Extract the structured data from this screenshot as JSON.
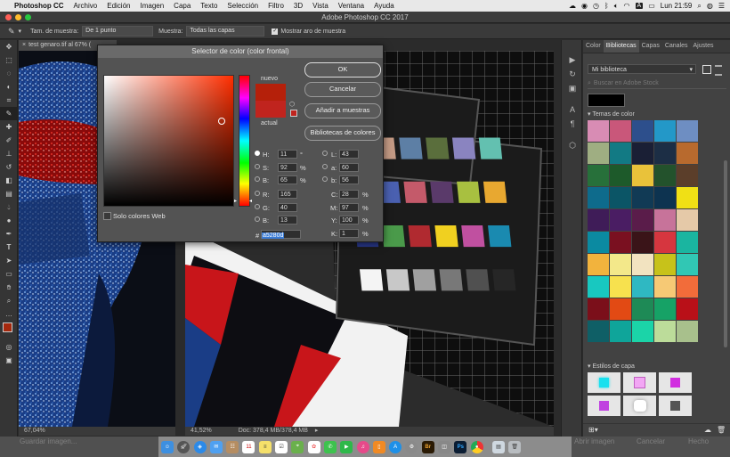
{
  "menubar": {
    "app": "Photoshop CC",
    "items": [
      "Archivo",
      "Edición",
      "Imagen",
      "Capa",
      "Texto",
      "Selección",
      "Filtro",
      "3D",
      "Vista",
      "Ventana",
      "Ayuda"
    ],
    "status": {
      "input_badge": "A",
      "clock": "Lun 21:59"
    }
  },
  "window": {
    "title": "Adobe Photoshop CC 2017"
  },
  "options": {
    "sample_size_label": "Tam. de muestra:",
    "sample_size_value": "De 1 punto",
    "sample_label": "Muestra:",
    "sample_value": "Todas las capas",
    "show_ring_label": "Mostrar aro de muestra"
  },
  "document": {
    "tab_title": "test genaro.tif al 67% (",
    "zoom_left": "67,04%",
    "zoom_right": "41,52%",
    "doc_size": "Doc: 378,4 MB/378,4 MB"
  },
  "dialog": {
    "title": "Selector de color (color frontal)",
    "new_label": "nuevo",
    "current_label": "actual",
    "ok": "OK",
    "cancel": "Cancelar",
    "add_swatches": "Añadir a muestras",
    "libraries": "Bibliotecas de colores",
    "web_only": "Solo colores Web",
    "new_color": "#b5200a",
    "current_color": "#c0241e",
    "hsb": {
      "H": "11",
      "S": "92",
      "B": "65",
      "H_unit": "°",
      "S_unit": "%",
      "B_unit": "%"
    },
    "rgb": {
      "R": "165",
      "G": "40",
      "B": "13"
    },
    "lab": {
      "L": "43",
      "a": "60",
      "b": "56"
    },
    "cmyk": {
      "C": "28",
      "M": "97",
      "Y": "100",
      "K": "1",
      "unit": "%"
    },
    "hex_prefix": "#",
    "hex": "a5280d"
  },
  "panel": {
    "tabs": [
      "Color",
      "Bibliotecas",
      "Capas",
      "Canales",
      "Ajustes"
    ],
    "library_name": "Mi biblioteca",
    "search_placeholder": "Buscar en Adobe Stock",
    "color_themes_label": "Temas de color",
    "layer_styles_label": "Estilos de capa",
    "swatches": [
      [
        "#d88cb4",
        "#c9577a",
        "#2d4f8c",
        "#2398c8",
        "#6e8ec2"
      ],
      [
        "#9fae82",
        "#127a84",
        "#1a1f35",
        "#1c2e45",
        "#b86a2e"
      ],
      [
        "#27703a",
        "#1d5a2a",
        "#e9c23a",
        "#23522c",
        "#5b3e2a"
      ],
      [
        "#0e6b8c",
        "#0b5566",
        "#113a55",
        "#0d3350",
        "#f0e015"
      ],
      [
        "#3f1c58",
        "#4a1d63",
        "#5a1c4a",
        "#c7739a",
        "#e5c9a8"
      ],
      [
        "#0b8aa1",
        "#7a1020",
        "#3a1418",
        "#d6363f",
        "#1ab5a0"
      ],
      [
        "#f2b33d",
        "#f3e88a",
        "#f2e3c0",
        "#c7c21a",
        "#31c7b4"
      ],
      [
        "#18c8c0",
        "#f7e14e",
        "#2fb8c2",
        "#f6c975",
        "#f26c3a"
      ],
      [
        "#7b0f1a",
        "#e24a14",
        "#1e8a56",
        "#16a266",
        "#b91018"
      ],
      [
        "#0f5f66",
        "#0fa59a",
        "#1bd4a8",
        "#bcdc9a",
        "#a8c08c"
      ]
    ]
  },
  "dock": {
    "ghost_left": "Guardar imagen...",
    "ghost_mid": "Abrir imagen",
    "ghost_cancel": "Cancelar",
    "ghost_done": "Hecho",
    "apps": [
      "finder",
      "launchpad",
      "safari",
      "mail",
      "contacts",
      "calendar",
      "notes",
      "reminders",
      "maps",
      "photos",
      "messages",
      "facetime",
      "itunes",
      "ibooks",
      "appstore",
      "preferences",
      "bridge",
      "capture",
      "photoshop",
      "chrome",
      "trash"
    ]
  }
}
